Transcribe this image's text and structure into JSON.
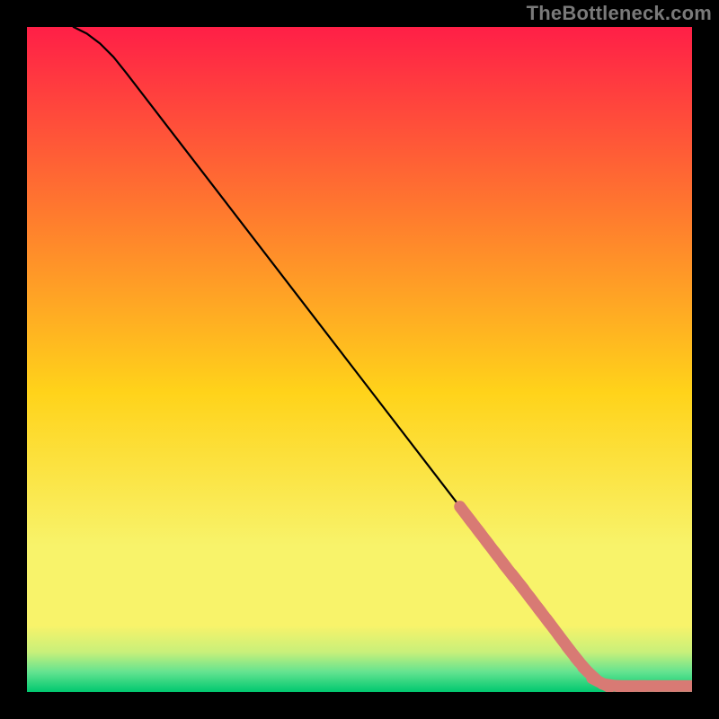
{
  "watermark": "TheBottleneck.com",
  "colors": {
    "bg": "#000000",
    "gradient_top": "#ff1f47",
    "gradient_mid_upper": "#ff7a2e",
    "gradient_mid": "#ffd31a",
    "gradient_mid_lower": "#f8f36a",
    "gradient_green1": "#c8f07a",
    "gradient_green2": "#63e390",
    "gradient_bottom": "#00c86f",
    "curve": "#000000",
    "marker": "#d87a74"
  },
  "chart_data": {
    "type": "line",
    "title": "",
    "xlabel": "",
    "ylabel": "",
    "xlim": [
      0,
      100
    ],
    "ylim": [
      0,
      100
    ],
    "grid": false,
    "legend": false,
    "series": [
      {
        "name": "curve",
        "x": [
          7,
          9,
          11,
          13,
          15,
          20,
          30,
          40,
          50,
          60,
          66,
          68,
          70,
          72,
          74,
          76,
          78,
          80,
          82,
          83,
          85,
          86.5,
          88,
          89.5,
          91.5,
          93.5,
          95,
          96.5,
          98.5
        ],
        "y": [
          100,
          99,
          97.5,
          95.5,
          93,
          86.5,
          73.5,
          60.5,
          47.5,
          34.5,
          26.7,
          24.1,
          21.5,
          18.9,
          16.3,
          13.7,
          11.1,
          8.5,
          5.9,
          4.6,
          2.2,
          1.3,
          1.0,
          0.9,
          0.9,
          0.9,
          0.9,
          0.9,
          0.9
        ]
      }
    ],
    "markers": [
      {
        "x": 66.0,
        "y": 26.7
      },
      {
        "x": 67.3,
        "y": 25.0
      },
      {
        "x": 68.6,
        "y": 23.3
      },
      {
        "x": 69.9,
        "y": 21.6
      },
      {
        "x": 71.2,
        "y": 19.9
      },
      {
        "x": 72.5,
        "y": 18.2
      },
      {
        "x": 73.8,
        "y": 16.6
      },
      {
        "x": 75.1,
        "y": 14.9
      },
      {
        "x": 76.4,
        "y": 13.2
      },
      {
        "x": 77.7,
        "y": 11.5
      },
      {
        "x": 79.0,
        "y": 9.8
      },
      {
        "x": 80.8,
        "y": 7.4
      },
      {
        "x": 82.1,
        "y": 5.7
      },
      {
        "x": 83.4,
        "y": 4.1
      },
      {
        "x": 84.7,
        "y": 2.7
      },
      {
        "x": 86.3,
        "y": 1.4
      },
      {
        "x": 88.0,
        "y": 1.0
      },
      {
        "x": 89.5,
        "y": 0.9
      },
      {
        "x": 91.5,
        "y": 0.9
      },
      {
        "x": 93.5,
        "y": 0.9
      },
      {
        "x": 96.0,
        "y": 0.9
      },
      {
        "x": 98.5,
        "y": 0.9
      }
    ]
  }
}
